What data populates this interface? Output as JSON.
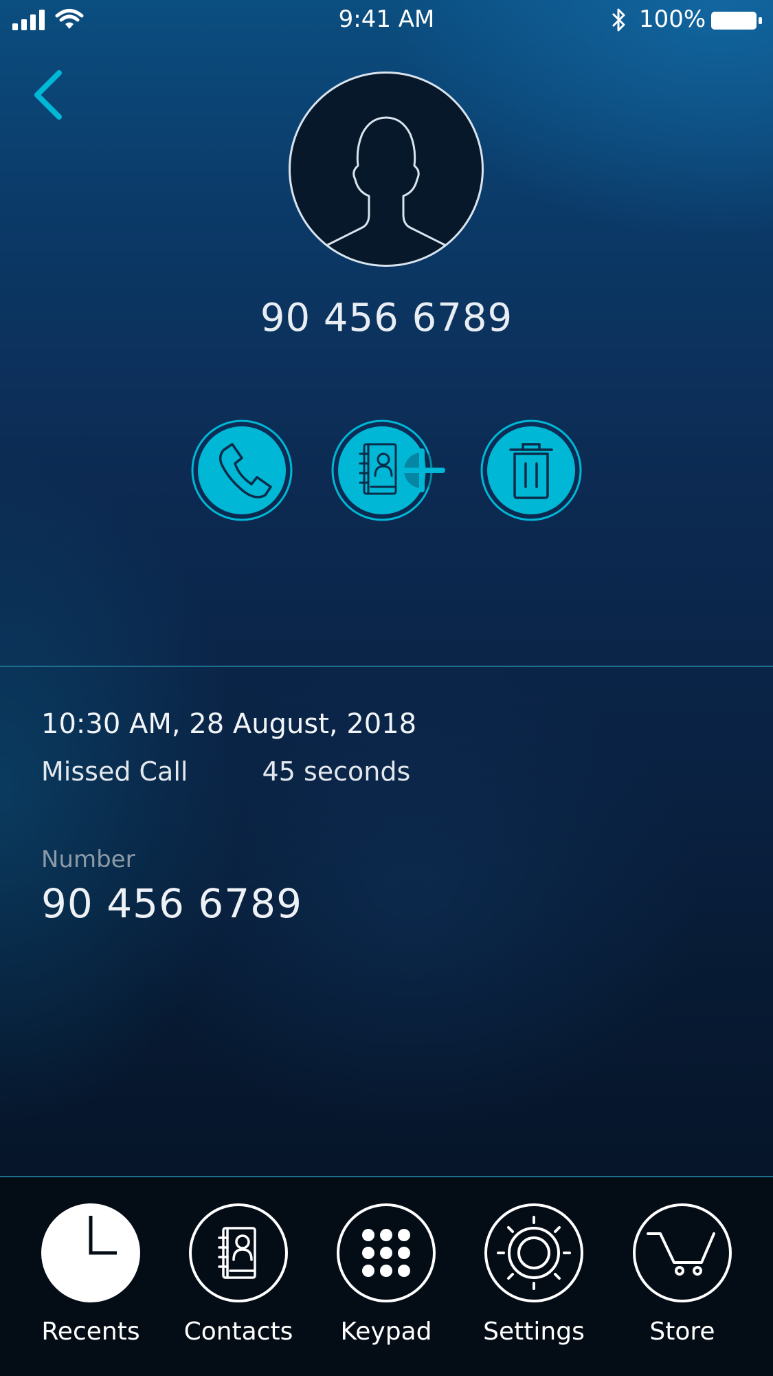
{
  "status_bar": {
    "time": "9:41 AM",
    "battery_percent": "100%",
    "icons": [
      "signal-icon",
      "wifi-icon",
      "bluetooth-icon",
      "battery-icon"
    ]
  },
  "header": {
    "back_icon": "chevron-left-icon",
    "avatar_icon": "person-silhouette-icon",
    "phone_number": "90 456 6789"
  },
  "actions": [
    {
      "name": "call",
      "icon": "phone-icon"
    },
    {
      "name": "add-contact",
      "icon": "contact-book-plus-icon"
    },
    {
      "name": "delete",
      "icon": "trash-icon"
    }
  ],
  "call_details": {
    "datetime": "10:30 AM, 28 August, 2018",
    "call_type": "Missed Call",
    "duration": "45 seconds",
    "number_label": "Number",
    "number_value": "90 456 6789"
  },
  "tab_bar": {
    "items": [
      {
        "label": "Recents",
        "icon": "clock-icon",
        "active": true
      },
      {
        "label": "Contacts",
        "icon": "contacts-icon",
        "active": false
      },
      {
        "label": "Keypad",
        "icon": "keypad-icon",
        "active": false
      },
      {
        "label": "Settings",
        "icon": "gear-icon",
        "active": false
      },
      {
        "label": "Store",
        "icon": "cart-icon",
        "active": false
      }
    ]
  },
  "colors": {
    "accent": "#00b7d6",
    "text": "#ffffff",
    "muted": "#8c9aa8",
    "divider": "#1d6d8c"
  }
}
